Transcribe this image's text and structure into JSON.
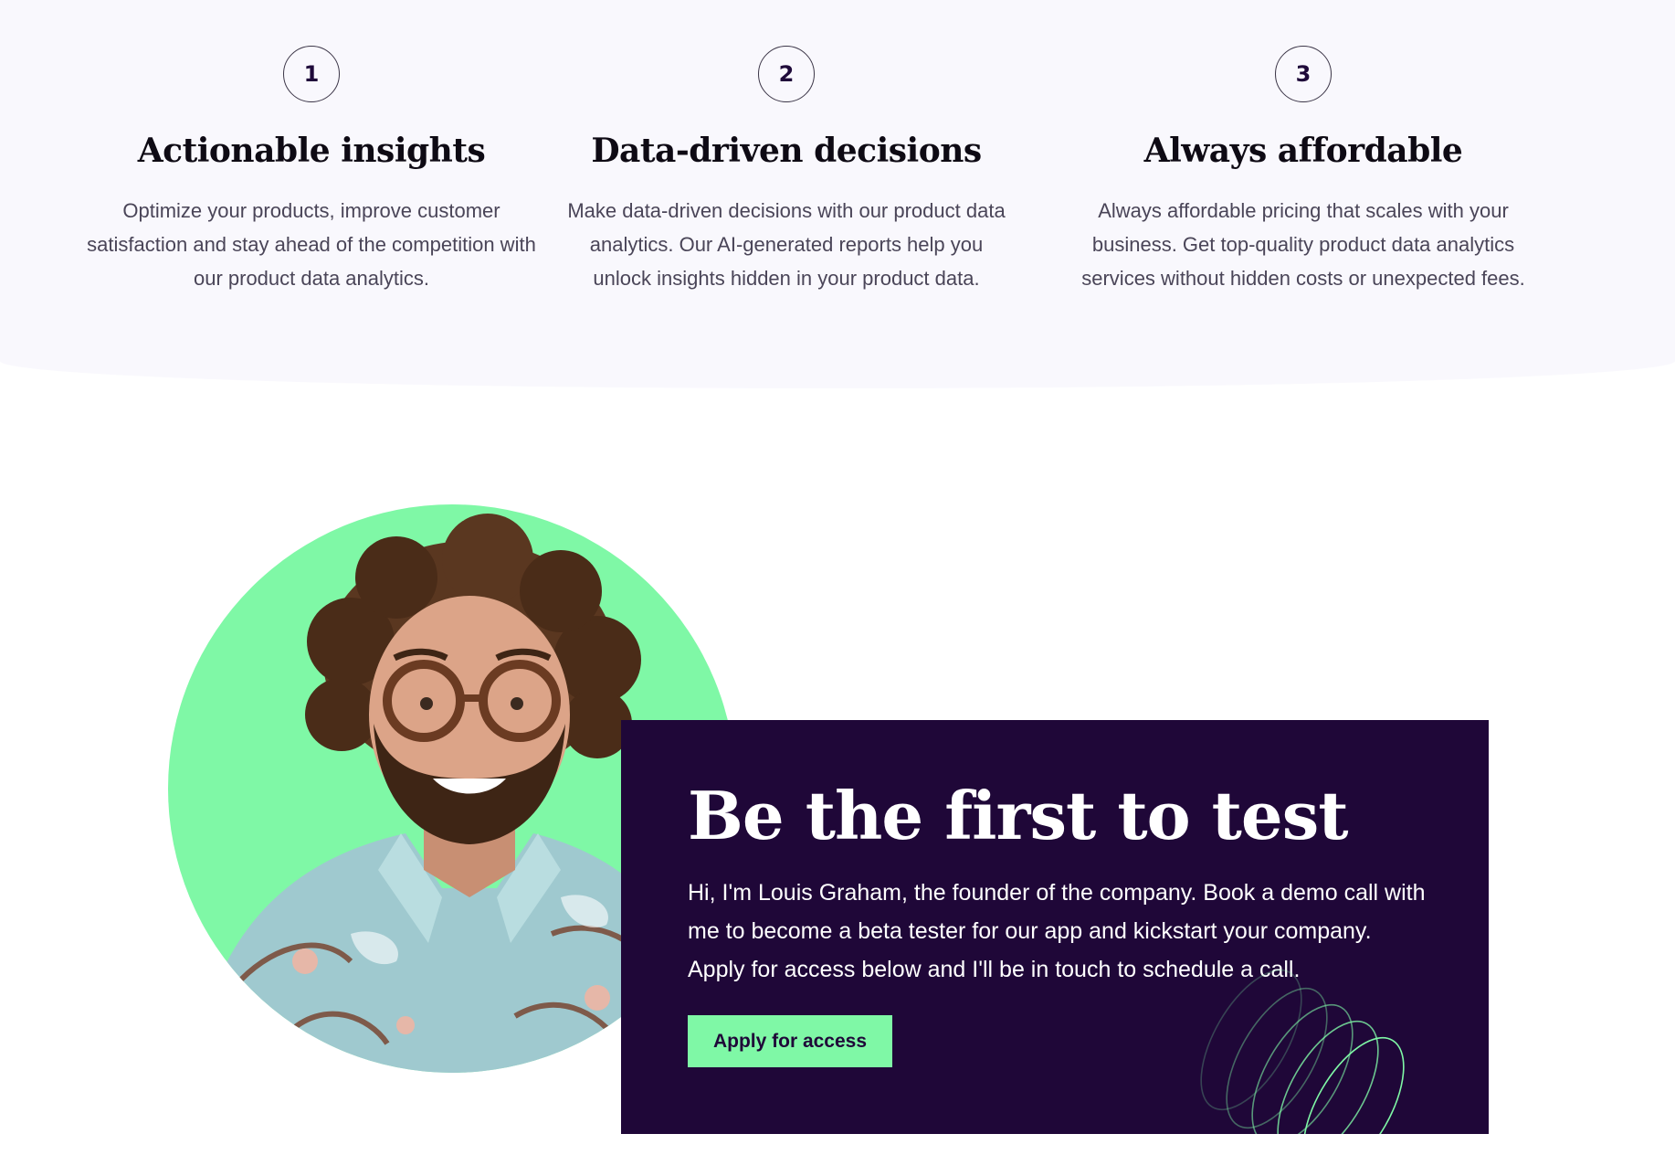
{
  "features": [
    {
      "number": "1",
      "title": "Actionable insights",
      "description": "Optimize your products, improve customer satisfaction and stay ahead of the competition with our product data analytics."
    },
    {
      "number": "2",
      "title": "Data-driven decisions",
      "description": "Make data-driven decisions with our product data analytics. Our AI-generated reports help you unlock insights hidden in your product data."
    },
    {
      "number": "3",
      "title": "Always affordable",
      "description": "Always affordable pricing that scales with your business. Get top-quality product data analytics services without hidden costs or unexpected fees."
    }
  ],
  "cta": {
    "title": "Be the first to test",
    "body": "Hi, I'm Louis Graham, the founder of the company. Book a demo call with me to become a beta tester for our app and kickstart your company. Apply for access below and I'll be in touch to schedule a call.",
    "button_label": "Apply for access"
  },
  "colors": {
    "accent_green": "#7ff8a6",
    "dark_purple": "#1f0738",
    "section_bg": "#f9f8fd"
  },
  "icons": {
    "decoration": "concentric-rings-icon"
  }
}
